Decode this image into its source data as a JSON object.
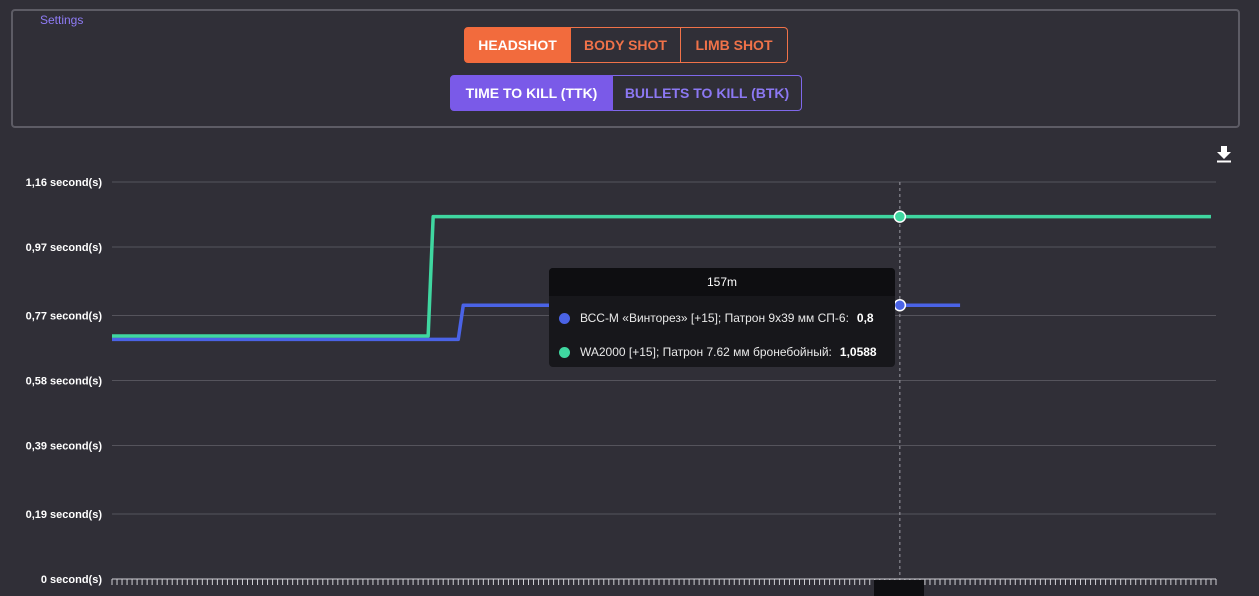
{
  "settings": {
    "legend": "Settings",
    "shot_buttons": [
      {
        "label": "HEADSHOT",
        "active": true
      },
      {
        "label": "BODY SHOT",
        "active": false
      },
      {
        "label": "LIMB SHOT",
        "active": false
      }
    ],
    "metric_buttons": [
      {
        "label": "TIME TO KILL (TTK)",
        "active": true
      },
      {
        "label": "BULLETS TO KILL (BTK)",
        "active": false
      }
    ]
  },
  "toolbar": {
    "download_icon": "download-icon"
  },
  "colors": {
    "background": "#302f37",
    "accent_orange": "#f26b3d",
    "accent_purple": "#7a5ae8",
    "series_vss": "#4a63e6",
    "series_wa2000": "#3fd7a0"
  },
  "tooltip": {
    "header": "157m",
    "rows": [
      {
        "label": "ВСС-М «Винторез» [+15]; Патрон 9х39 мм СП-6:",
        "value": "0,8"
      },
      {
        "label": "WA2000 [+15]; Патрон 7.62 мм бронебойный:",
        "value": "1,0588"
      }
    ]
  },
  "chart_data": {
    "type": "line",
    "x_unit": "m",
    "xlim": [
      0,
      220
    ],
    "ylim": [
      0,
      1.16
    ],
    "y_ticks": [
      {
        "value": 0,
        "label": "0 second(s)"
      },
      {
        "value": 0.19,
        "label": "0,19 second(s)"
      },
      {
        "value": 0.39,
        "label": "0,39 second(s)"
      },
      {
        "value": 0.58,
        "label": "0,58 second(s)"
      },
      {
        "value": 0.77,
        "label": "0,77 second(s)"
      },
      {
        "value": 0.97,
        "label": "0,97 second(s)"
      },
      {
        "value": 1.16,
        "label": "1,16 second(s)"
      }
    ],
    "grid": true,
    "hover_x": 157,
    "series": [
      {
        "name": "ВСС-М «Винторез» [+15]; Патрон 9х39 мм СП-6",
        "color": "#4a63e6",
        "points": [
          [
            0,
            0.7
          ],
          [
            69,
            0.7
          ],
          [
            70,
            0.8
          ],
          [
            169,
            0.8
          ]
        ]
      },
      {
        "name": "WA2000 [+15]; Патрон 7.62 мм бронебойный",
        "color": "#3fd7a0",
        "points": [
          [
            0,
            0.71
          ],
          [
            63,
            0.71
          ],
          [
            64,
            1.0588
          ],
          [
            219,
            1.0588
          ]
        ]
      }
    ]
  }
}
